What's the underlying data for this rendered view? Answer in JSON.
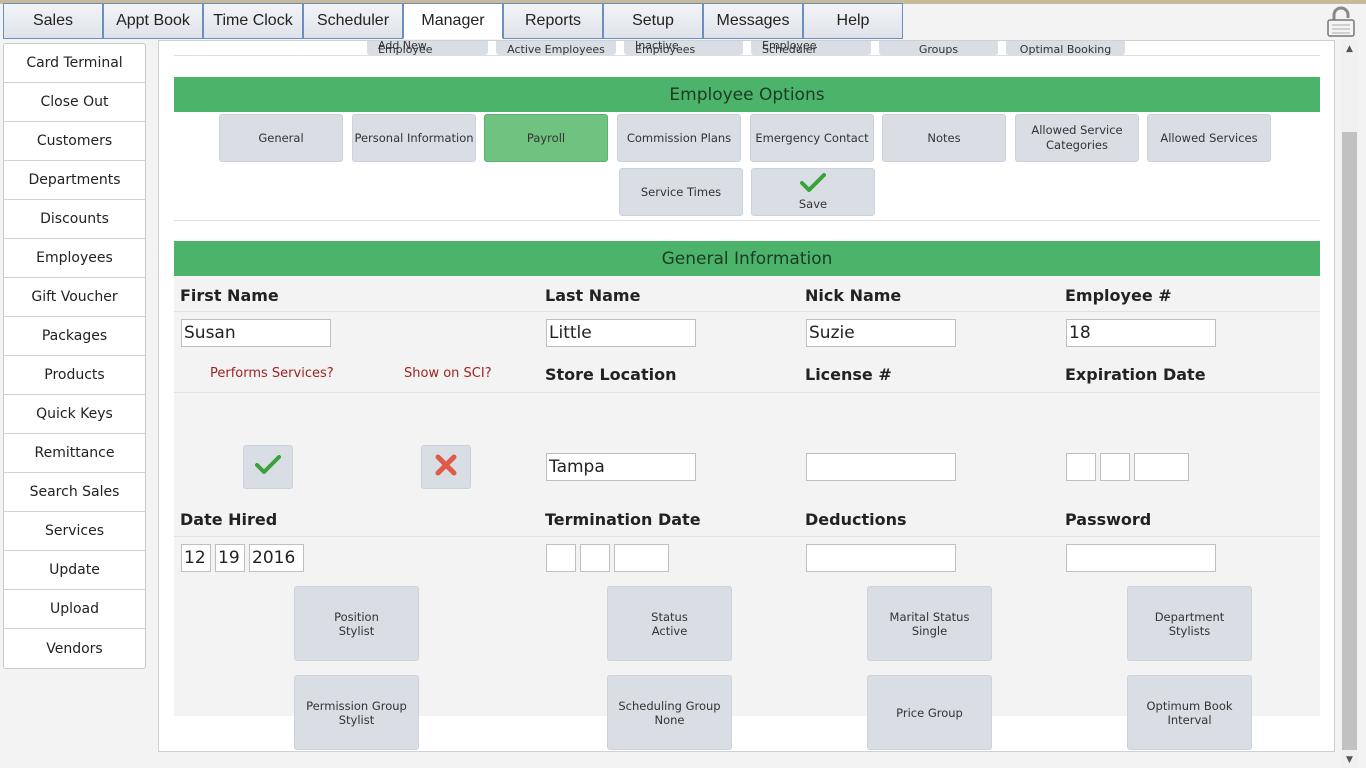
{
  "top_tabs": [
    "Sales",
    "Appt Book",
    "Time Clock",
    "Scheduler",
    "Manager",
    "Reports",
    "Setup",
    "Messages",
    "Help"
  ],
  "active_top_tab": "Manager",
  "left_nav": [
    "Card Terminal",
    "Close Out",
    "Customers",
    "Departments",
    "Discounts",
    "Employees",
    "Gift Voucher",
    "Packages",
    "Products",
    "Quick Keys",
    "Remittance",
    "Search Sales",
    "Services",
    "Update",
    "Upload",
    "Vendors"
  ],
  "sub_nav": [
    "Add New Employee",
    "Active Employees",
    "Inactive Employees",
    "Employee Scheduler",
    "Groups",
    "Optimal Booking"
  ],
  "employee_options": {
    "title": "Employee Options",
    "buttons": [
      "General",
      "Personal Information",
      "Payroll",
      "Commission Plans",
      "Emergency Contact",
      "Notes",
      "Allowed Service Categories",
      "Allowed Services"
    ],
    "active": "Payroll",
    "service_times": "Service Times",
    "save": "Save"
  },
  "general": {
    "title": "General Information",
    "first_name_label": "First Name",
    "last_name_label": "Last Name",
    "nick_name_label": "Nick Name",
    "employee_num_label": "Employee #",
    "first_name": "Susan",
    "last_name": "Little",
    "nick_name": "Suzie",
    "employee_num": "18",
    "performs_services_label": "Performs Services?",
    "show_on_sci_label": "Show on SCI?",
    "performs_services": true,
    "show_on_sci": false,
    "store_location_label": "Store Location",
    "license_label": "License #",
    "expiration_label": "Expiration Date",
    "store_location": "Tampa",
    "license": "",
    "expiration_month": "",
    "expiration_day": "",
    "expiration_year": "",
    "date_hired_label": "Date Hired",
    "termination_label": "Termination Date",
    "deductions_label": "Deductions",
    "password_label": "Password",
    "hired_month": "12",
    "hired_day": "19",
    "hired_year": "2016",
    "term_month": "",
    "term_day": "",
    "term_year": "",
    "deductions": "",
    "password": "",
    "position_label": "Position",
    "position_value": "Stylist",
    "status_label": "Status",
    "status_value": "Active",
    "marital_label": "Marital Status",
    "marital_value": "Single",
    "department_label": "Department",
    "department_value": "Stylists",
    "permission_label": "Permission Group",
    "permission_value": "Stylist",
    "scheduling_label": "Scheduling Group",
    "scheduling_value": "None",
    "price_group_label": "Price Group",
    "optimum_label": "Optimum Book",
    "optimum_value": "Interval"
  },
  "colors": {
    "header_green": "#4cb46a",
    "active_green": "#6fc27f",
    "button_gray": "#d9dde4",
    "red_label": "#a02222"
  }
}
